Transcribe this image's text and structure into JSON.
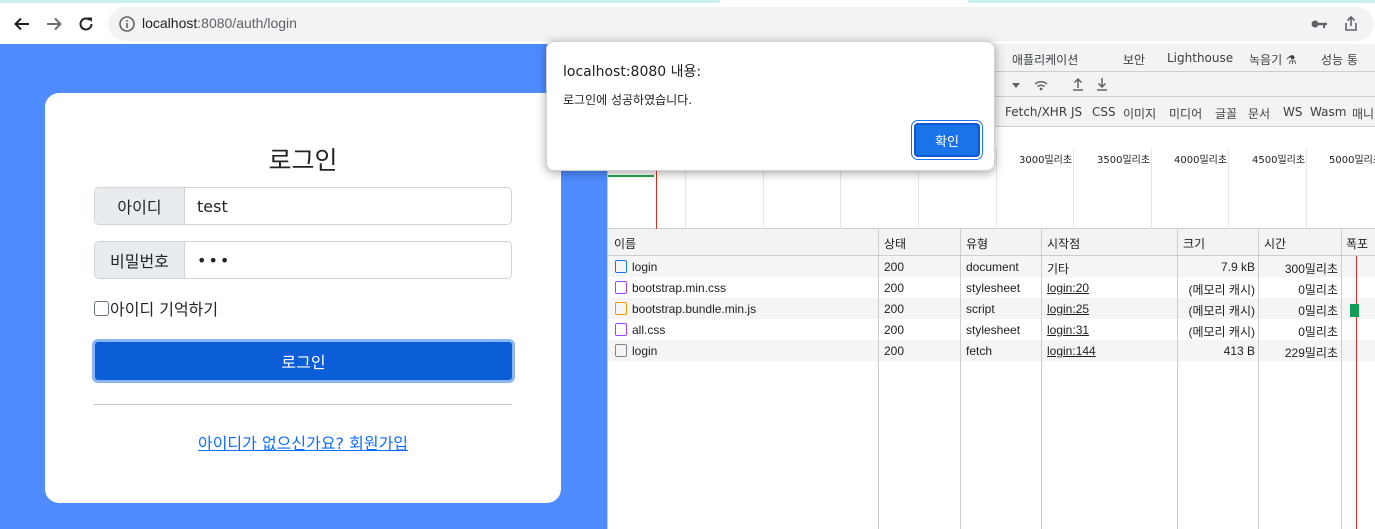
{
  "browser": {
    "back_icon": "arrow-left-icon",
    "forward_icon": "arrow-right-icon",
    "reload_icon": "reload-icon",
    "url_host": "localhost",
    "url_path": ":8080/auth/login"
  },
  "login_page": {
    "title": "로그인",
    "username_label": "아이디",
    "username_value": "test",
    "password_label": "비밀번호",
    "password_value": "•••",
    "remember_label": "아이디 기억하기",
    "submit_label": "로그인",
    "signup_link": "아이디가 없으신가요? 회원가입",
    "colors": {
      "background": "#4e8cff",
      "button": "#0b5ed7",
      "link": "#0d6efd"
    }
  },
  "dialog": {
    "title": "localhost:8080 내용:",
    "message": "로그인에 성공하였습니다.",
    "ok_label": "확인"
  },
  "devtools": {
    "tabs": [
      "애플리케이션",
      "보안",
      "Lighthouse",
      "녹음기 ⚗",
      "성능 통"
    ],
    "filters": [
      "Fetch/XHR",
      "JS",
      "CSS",
      "이미지",
      "미디어",
      "글꼴",
      "문서",
      "WS",
      "Wasm",
      "매니"
    ],
    "timeline_labels": [
      "3000밀리초",
      "3500밀리초",
      "4000밀리초",
      "4500밀리초",
      "5000밀리초"
    ],
    "columns": [
      "이름",
      "상태",
      "유형",
      "시작점",
      "크기",
      "시간",
      "폭포"
    ],
    "rows": [
      {
        "name": "login",
        "status": "200",
        "type": "document",
        "initiator": "기타",
        "size": "7.9 kB",
        "time": "300밀리초",
        "icon": "document-icon",
        "color": "#1a73e8"
      },
      {
        "name": "bootstrap.min.css",
        "status": "200",
        "type": "stylesheet",
        "initiator": "login:20",
        "size": "(메모리 캐시)",
        "time": "0밀리초",
        "icon": "stylesheet-icon",
        "color": "#a142f4"
      },
      {
        "name": "bootstrap.bundle.min.js",
        "status": "200",
        "type": "script",
        "initiator": "login:25",
        "size": "(메모리 캐시)",
        "time": "0밀리초",
        "icon": "script-icon",
        "color": "#f29900"
      },
      {
        "name": "all.css",
        "status": "200",
        "type": "stylesheet",
        "initiator": "login:31",
        "size": "(메모리 캐시)",
        "time": "0밀리초",
        "icon": "stylesheet-icon",
        "color": "#a142f4"
      },
      {
        "name": "login",
        "status": "200",
        "type": "fetch",
        "initiator": "login:144",
        "size": "413 B",
        "time": "229밀리초",
        "icon": "fetch-icon",
        "color": "#80868b"
      }
    ]
  }
}
